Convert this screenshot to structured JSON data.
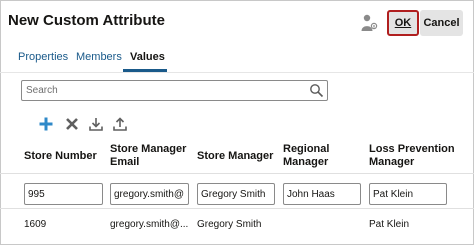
{
  "dialog": {
    "title": "New Custom Attribute",
    "ok_label": "OK",
    "cancel_label": "Cancel"
  },
  "tabs": [
    {
      "label": "Properties",
      "active": false
    },
    {
      "label": "Members",
      "active": false
    },
    {
      "label": "Values",
      "active": true
    }
  ],
  "search": {
    "placeholder": "Search",
    "value": ""
  },
  "toolbar": {
    "icons": [
      "add-icon",
      "delete-icon",
      "download-icon",
      "upload-icon"
    ],
    "add_color": "#2f89c8"
  },
  "table": {
    "columns": [
      "Store Number",
      "Store Manager Email",
      "Store Manager",
      "Regional Manager",
      "Loss Prevention Manager"
    ],
    "edit_row": [
      "995",
      "gregory.smith@",
      "Gregory Smith",
      "John Haas",
      "Pat Klein"
    ],
    "rows": [
      [
        "1609",
        "gregory.smith@...",
        "Gregory Smith",
        "",
        "Pat Klein"
      ]
    ]
  },
  "colors": {
    "accent": "#1a5a8a",
    "ok_border": "#b01f1f",
    "button_bg": "#e4e4e4"
  }
}
